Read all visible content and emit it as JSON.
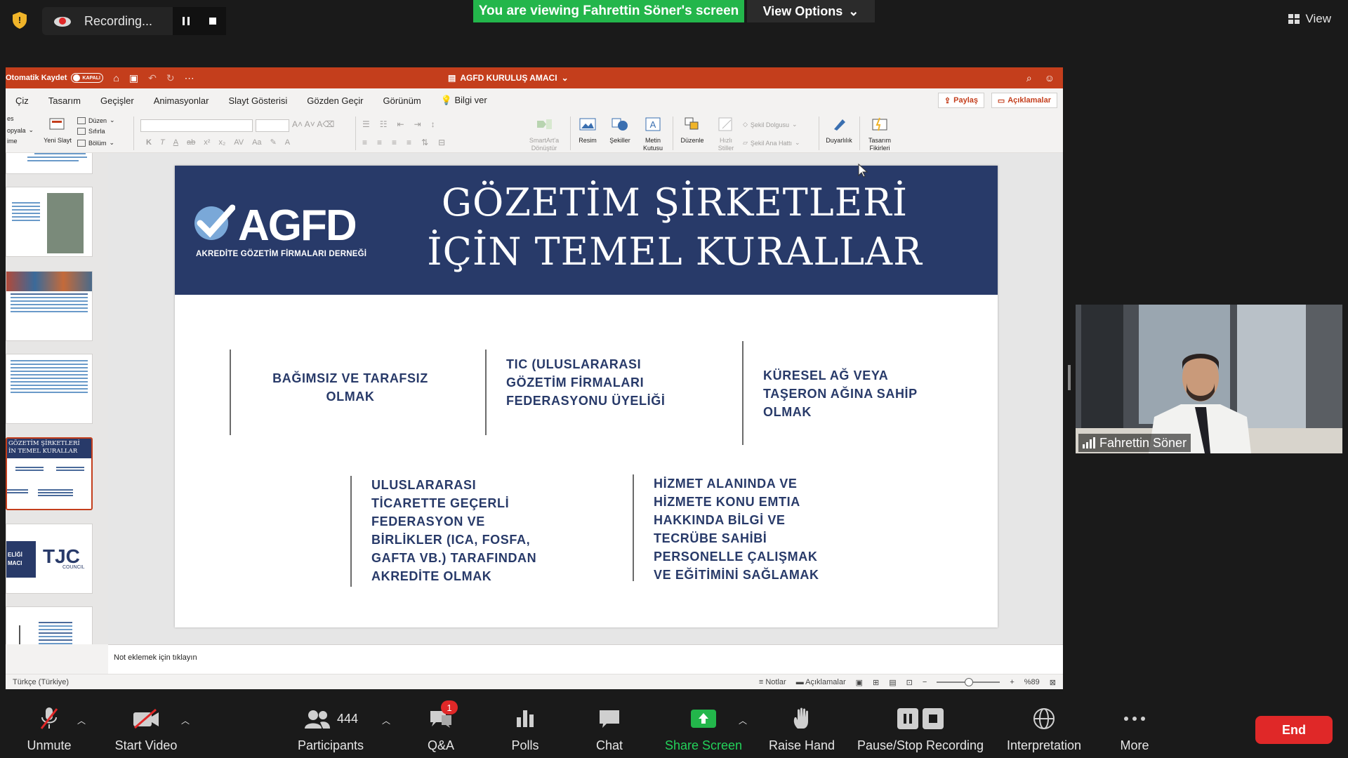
{
  "zoom": {
    "recording_label": "Recording...",
    "viewing_banner": "You are viewing Fahrettin Söner's screen",
    "view_options": "View Options",
    "view_button": "View",
    "participant_name": "Fahrettin Söner",
    "toolbar": {
      "unmute": "Unmute",
      "start_video": "Start Video",
      "participants": "Participants",
      "participants_count": "444",
      "qa": "Q&A",
      "qa_badge": "1",
      "polls": "Polls",
      "chat": "Chat",
      "share_screen": "Share Screen",
      "raise_hand": "Raise Hand",
      "pause_stop": "Pause/Stop Recording",
      "interpretation": "Interpretation",
      "more": "More",
      "end": "End"
    },
    "colors": {
      "share_green": "#23b64b",
      "end_red": "#e02828"
    }
  },
  "ppt": {
    "autosave": "Otomatik Kaydet",
    "toggle": "KAPALI",
    "doc_title": "AGFD KURULUŞ AMACI",
    "tabs": [
      "Çiz",
      "Tasarım",
      "Geçişler",
      "Animasyonlar",
      "Slayt Gösterisi",
      "Gözden Geçir",
      "Görünüm"
    ],
    "help": "Bilgi ver",
    "share": "Paylaş",
    "comments": "Açıklamalar",
    "ribbon": {
      "paste": "opyala",
      "paste2": "ime",
      "new_slide": "Yeni Slayt",
      "layout": "Düzen",
      "reset": "Sıfırla",
      "section": "Bölüm",
      "smartart": "SmartArt'a Dönüştür",
      "picture": "Resim",
      "shapes": "Şekiller",
      "textbox": "Metin Kutusu",
      "arrange": "Düzenle",
      "quick_styles": "Hızlı Stiller",
      "shape_fill": "Şekil Dolgusu",
      "shape_outline": "Şekil Ana Hattı",
      "sensitivity": "Duyarlılık",
      "design_ideas": "Tasarım Fikirleri"
    },
    "thumb_titles": [
      "GÖZETİM ŞİRKETLERİ",
      "İN TEMEL KURALLAR"
    ],
    "thumb_logo": "TJC",
    "thumb_council": "COUNCIL",
    "thumb_eligi": "ELİĞİ",
    "thumb_maci": "MACI",
    "notes_placeholder": "Not eklemek için tıklayın",
    "status": {
      "language": "Türkçe (Türkiye)",
      "notes": "Notlar",
      "comments": "Açıklamalar",
      "zoom": "%89"
    },
    "slide": {
      "logo": "AGFD",
      "logo_sub": "AKREDİTE GÖZETİM FİRMALARI DERNEĞİ",
      "title_line1": "GÖZETİM ŞİRKETLERİ",
      "title_line2": "İÇİN TEMEL KURALLAR",
      "items": [
        "BAĞIMSIZ VE TARAFSIZ\nOLMAK",
        "TIC (ULUSLARARASI\nGÖZETİM FİRMALARI\nFEDERASYONU ÜYELİĞİ",
        "KÜRESEL AĞ VEYA\nTAŞERON AĞINA SAHİP\nOLMAK",
        "ULUSLARARASI\nTİCARETTE GEÇERLİ\nFEDERASYON VE\nBİRLİKLER (ICA, FOSFA,\nGAFTA VB.) TARAFINDAN\nAKREDİTE OLMAK",
        "HİZMET ALANINDA VE\nHİZMETE KONU EMTIA\nHAKKINDA BİLGİ VE\nTECRÜBE SAHİBİ\nPERSONELLE ÇALIŞMAK\nVE EĞİTİMİNİ SAĞLAMAK"
      ],
      "colors": {
        "banner": "#283a69",
        "accent": "#c43e1c"
      }
    }
  }
}
